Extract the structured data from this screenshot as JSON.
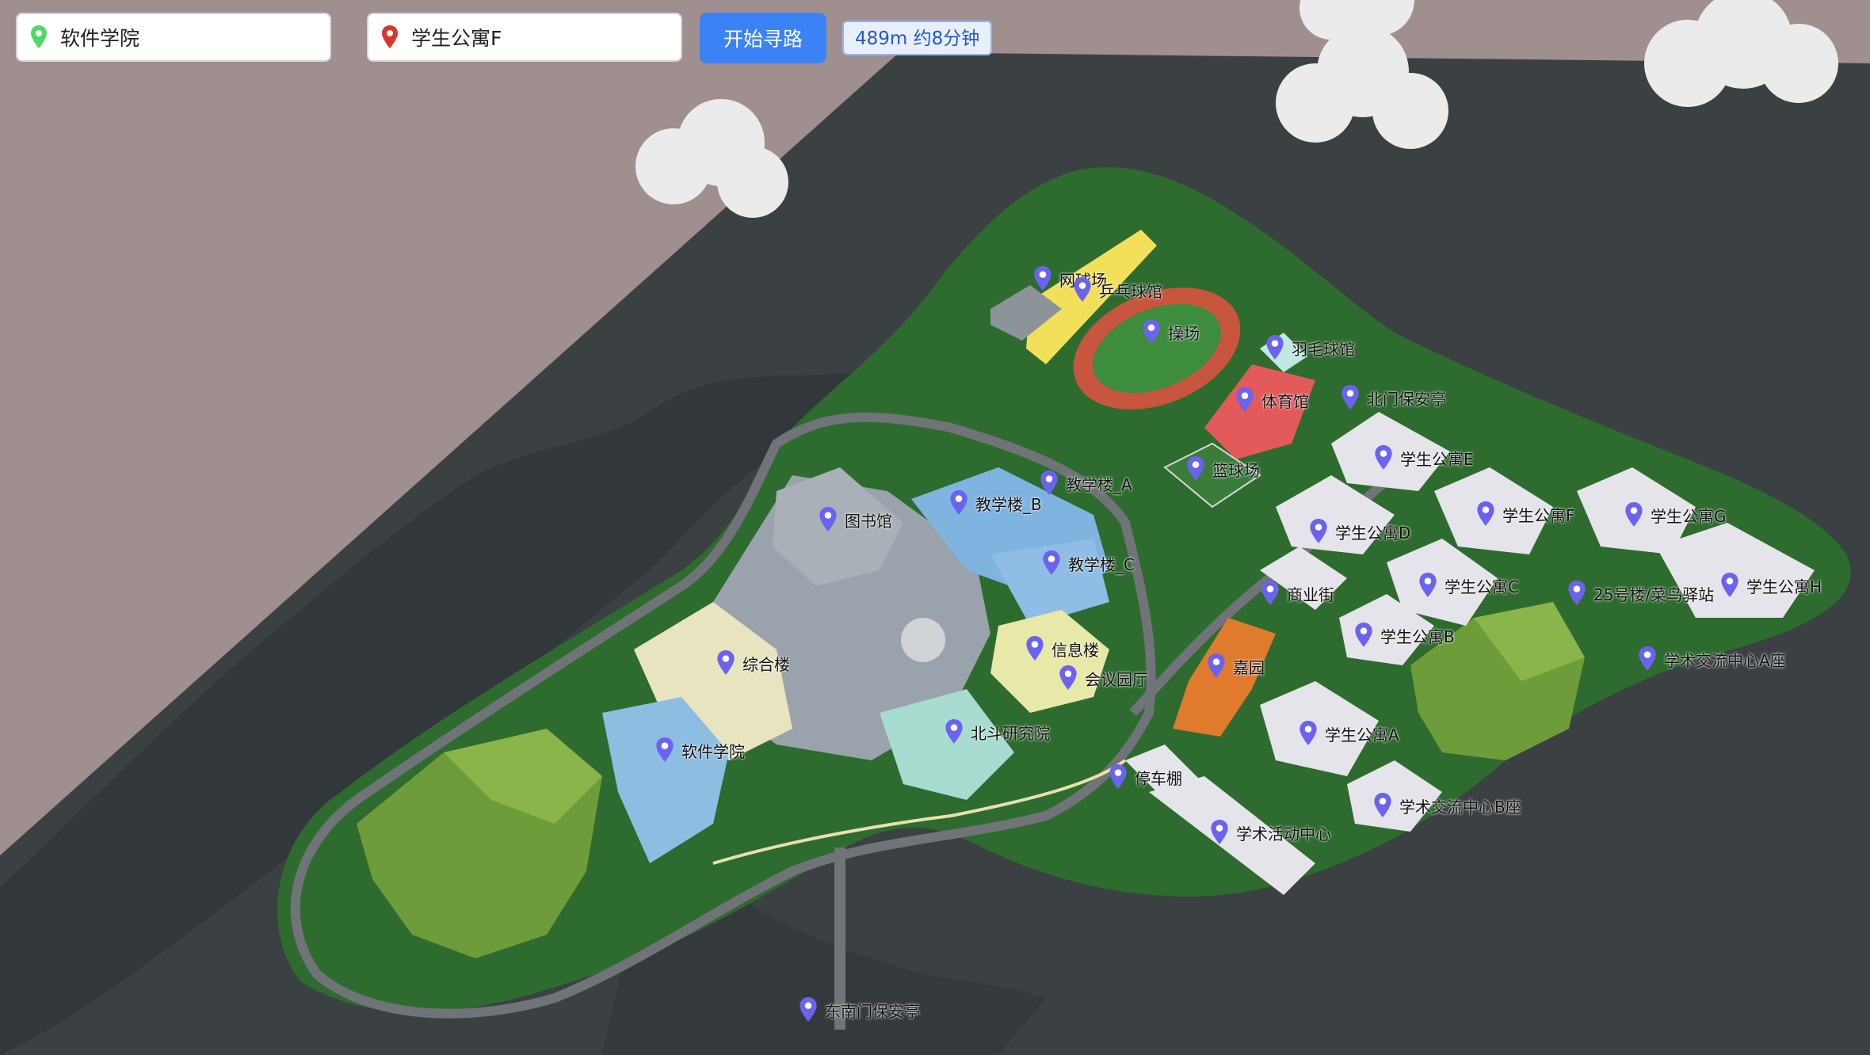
{
  "search": {
    "start_value": "软件学院",
    "end_value": "学生公寓F",
    "start_pin_color": "#4cd964",
    "end_pin_color": "#d9352b",
    "route_button_label": "开始寻路",
    "route_summary": "489m 约8分钟"
  },
  "colors": {
    "sky": "#a08f8f",
    "ground_plate": "#3b4043",
    "campus_grass": "#2e6b2e",
    "road": "#6c7074",
    "marker": "#6b63f0"
  },
  "pois": [
    {
      "label": "网球场"
    },
    {
      "label": "乒乓球馆"
    },
    {
      "label": "操场"
    },
    {
      "label": "羽毛球馆"
    },
    {
      "label": "体育馆"
    },
    {
      "label": "北门保安亭"
    },
    {
      "label": "篮球场"
    },
    {
      "label": "教学楼_A"
    },
    {
      "label": "教学楼_B"
    },
    {
      "label": "图书馆"
    },
    {
      "label": "教学楼_C"
    },
    {
      "label": "学生公寓E"
    },
    {
      "label": "学生公寓D"
    },
    {
      "label": "学生公寓F"
    },
    {
      "label": "学生公寓G"
    },
    {
      "label": "商业街"
    },
    {
      "label": "学生公寓C"
    },
    {
      "label": "25号楼/菜鸟驿站"
    },
    {
      "label": "学生公寓H"
    },
    {
      "label": "学生公寓B"
    },
    {
      "label": "信息楼"
    },
    {
      "label": "综合楼"
    },
    {
      "label": "会议园厅"
    },
    {
      "label": "嘉园"
    },
    {
      "label": "学术交流中心A座"
    },
    {
      "label": "北斗研究院"
    },
    {
      "label": "学生公寓A"
    },
    {
      "label": "软件学院"
    },
    {
      "label": "停车棚"
    },
    {
      "label": "学术交流中心B座"
    },
    {
      "label": "学术活动中心"
    },
    {
      "label": "东南门保安亭"
    }
  ]
}
